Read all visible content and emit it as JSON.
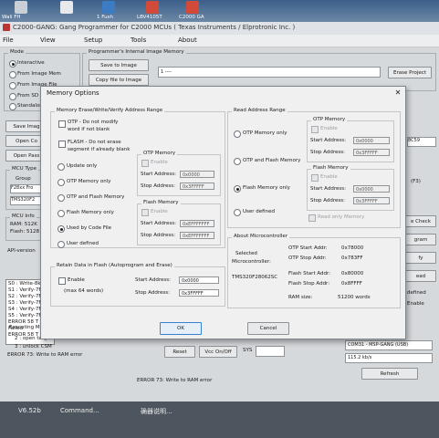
{
  "desktop": {
    "labels": [
      "Wali FH",
      "1 Fush",
      "LBV4105T",
      "C2000 GA"
    ]
  },
  "window": {
    "title": "C2000-GANG: Gang Programmer for C2000 MCUs ( Texas Instruments / Elprotronic Inc. )",
    "menu": [
      "File",
      "View",
      "Setup",
      "Tools",
      "About"
    ]
  },
  "mode": {
    "title": "Mode",
    "options": [
      "Interactive",
      "From Image Mem",
      "From Image File",
      "From SD",
      "Standalone"
    ]
  },
  "image_memory": {
    "title": "Programmer's Internal Image Memory",
    "save_label": "Save to Image",
    "copy_label": "Copy file to Image",
    "selected": "1 ----",
    "erase_project_label": "Erase Project"
  },
  "left_buttons": [
    "Save Imag",
    "Open Co",
    "Open Pass"
  ],
  "mcu_type": {
    "title": "MCU Type",
    "group_label": "Group",
    "group_value": "F28xx Fro",
    "device_value": "TMS320F2"
  },
  "mcu_info": {
    "title": "MCU Info",
    "ram": "RAM: 512K",
    "flash": "Flash: 5128"
  },
  "api_version": "API-version",
  "log_lines": [
    "S0 : Write-8k",
    "S1 : Verify-7F",
    "S2 : Verify-7F",
    "S3 : Verify-7F",
    "S4 : Verify-7F",
    "S5 : Verify-7F",
    "ERROR 58 T",
    "Failed",
    "ERROR 58 T"
  ],
  "executing": "Executing M",
  "steps": [
    "2 : open targ",
    "3 : unlock CSM"
  ],
  "error_line_1": "ERROR 73: Write to RAM error",
  "controls": {
    "reset_label": "Reset",
    "vcc_label": "Vcc On/Off",
    "sys_label": "SYS"
  },
  "status_error": "ERROR 73: Write to RAM error",
  "com_port": "COM31 - MSP-GANG (USB)",
  "baud_rate": "115.2 kb/s",
  "refresh_label": "Refresh",
  "right_side": {
    "cs_value": "8C59",
    "f3_label": "(F3)",
    "check_label": "e Check",
    "ram_label": "gram",
    "fy_label": "fy",
    "ead_label": "ead",
    "defined_label": "defined",
    "enable_label": "Enable"
  },
  "taskbar": {
    "version": "V6.52b",
    "command": "Command...",
    "chinese": "确器说明..."
  },
  "dialog": {
    "title": "Memory Options",
    "write_group": {
      "title": "Memory Erase/Write/Verify Address Range",
      "otp_label": "OTP - Do not modify",
      "otp_label2": "word if not blank",
      "flash_label": "FLASH - Do not erase",
      "flash_label2": "segment if already blank",
      "options": [
        "Update only",
        "OTP Memory only",
        "OTP and Flash Memory",
        "Flash Memory only",
        "Used by Code File",
        "User defined"
      ],
      "otp_memory": {
        "title": "OTP Memory",
        "enable": "Enable",
        "start_label": "Start Address:",
        "start_value": "0x0000",
        "stop_label": "Stop Address:",
        "stop_value": "0x3FFFFF"
      },
      "flash_memory": {
        "title": "Flash Memory",
        "enable": "Enable",
        "start_label": "Start Address:",
        "start_value": "0xEFFFFFFF",
        "stop_label": "Stop Address:",
        "stop_value": "0xEFFFFFFF"
      }
    },
    "retain_group": {
      "title": "Retain Data in Flash   (Autoprogram and Erase)",
      "enable": "Enable",
      "max": "(max 64 words)",
      "start_label": "Start Address:",
      "start_value": "0x0000",
      "stop_label": "Stop Address:",
      "stop_value": "0x3FFFFF"
    },
    "read_group": {
      "title": "Read Address Range",
      "options": [
        "OTP Memory only",
        "OTP and Flash Memory",
        "Flash Memory only",
        "User defined"
      ],
      "otp_memory": {
        "title": "OTP Memory",
        "enable": "Enable",
        "start_label": "Start Address:",
        "start_value": "0x0000",
        "stop_label": "Stop Address:",
        "stop_value": "0x3FFFFF"
      },
      "flash_memory": {
        "title": "Flash Memory",
        "enable": "Enable",
        "start_label": "Start Address:",
        "start_value": "0x0000",
        "stop_label": "Stop Address:",
        "stop_value": "0x3FFFFF"
      },
      "read_only": "Read only Memory"
    },
    "about": {
      "title": "About Microcontroller",
      "selected_label": "Selected",
      "microcontroller_label": "Microcontroller:",
      "device": "TMS320F28062SC",
      "otp_start_label": "OTP Start Addr:",
      "otp_start": "0x78000",
      "otp_stop_label": "OTP Stop Addr:",
      "otp_stop": "0x783FF",
      "flash_start_label": "Flash Start Addr:",
      "flash_start": "0x80000",
      "flash_stop_label": "Flash Stop Addr:",
      "flash_stop": "0x8FFFF",
      "ram_label": "RAM size:",
      "ram_value": "51200  words"
    },
    "ok_label": "OK",
    "cancel_label": "Cancel"
  }
}
